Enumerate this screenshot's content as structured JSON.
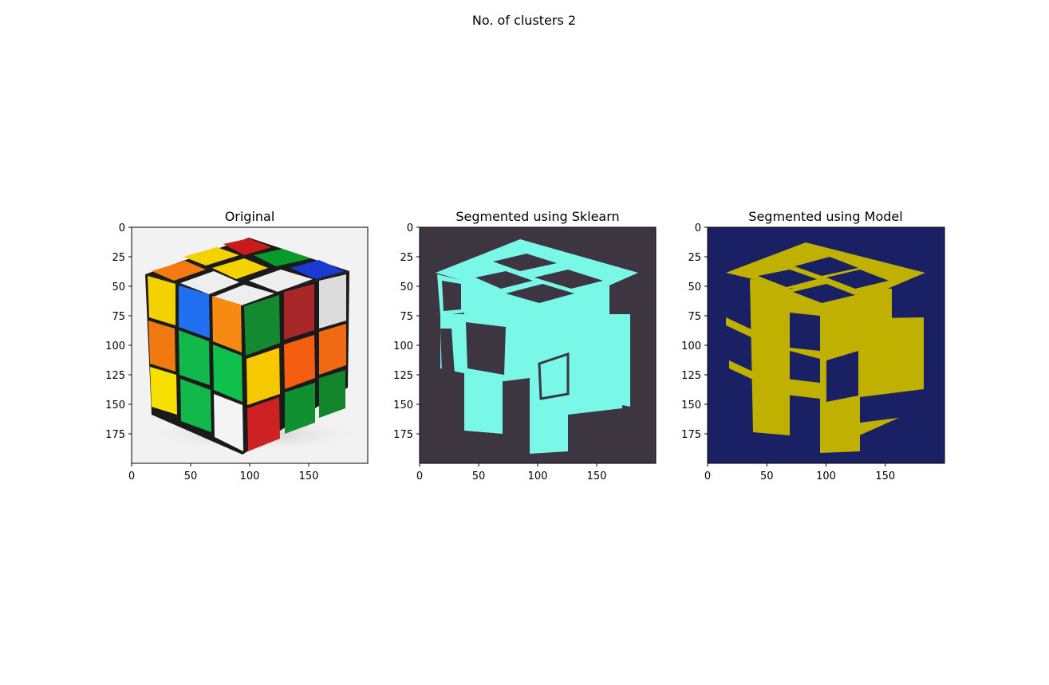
{
  "figure": {
    "suptitle": "No. of clusters 2"
  },
  "chart_data": [
    {
      "type": "image",
      "title": "Original",
      "xticks": [
        0,
        50,
        100,
        150
      ],
      "yticks": [
        0,
        25,
        50,
        75,
        100,
        125,
        150,
        175
      ],
      "xlim": [
        0,
        200
      ],
      "ylim": [
        200,
        0
      ],
      "background_color": "#f2f2f2"
    },
    {
      "type": "image",
      "title": "Segmented using Sklearn",
      "xticks": [
        0,
        50,
        100,
        150
      ],
      "yticks": [
        0,
        25,
        50,
        75,
        100,
        125,
        150,
        175
      ],
      "xlim": [
        0,
        200
      ],
      "ylim": [
        200,
        0
      ],
      "background_color": "#3d3540",
      "foreground_color": "#79f8e8"
    },
    {
      "type": "image",
      "title": "Segmented using Model",
      "xticks": [
        0,
        50,
        100,
        150
      ],
      "yticks": [
        0,
        25,
        50,
        75,
        100,
        125,
        150,
        175
      ],
      "xlim": [
        0,
        200
      ],
      "ylim": [
        200,
        0
      ],
      "background_color": "#192164",
      "foreground_color": "#c0b000"
    }
  ]
}
